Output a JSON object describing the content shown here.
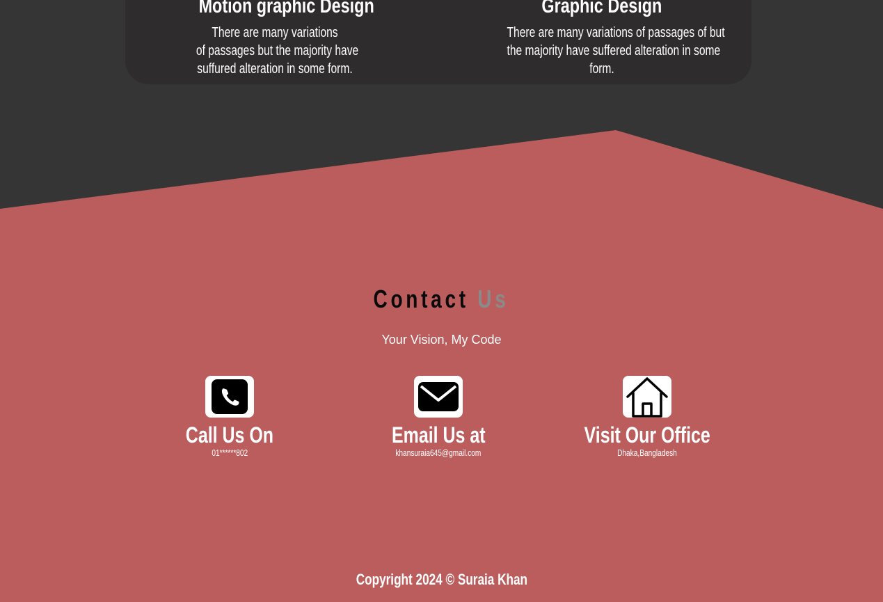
{
  "services": [
    {
      "title": "Motion graphic Design",
      "desc_lines": [
        "There are many variations",
        "of passages but the majority have",
        "suffured alteration in some form."
      ]
    },
    {
      "title": "Graphic Design",
      "desc_lines": [
        "There are many variations of passages of but",
        "the majority have suffered alteration in some",
        "form."
      ]
    }
  ],
  "contact": {
    "title_main": "Contact",
    "title_accent": "Us",
    "tagline": "Your Vision, My Code",
    "cards": [
      {
        "icon": "phone-icon",
        "title": "Call Us On",
        "value": "01******802"
      },
      {
        "icon": "envelope-icon",
        "title": "Email Us at",
        "value": "khansuraia645@gmail.com"
      },
      {
        "icon": "home-icon",
        "title": "Visit Our Office",
        "value": "Dhaka,Bangladesh"
      }
    ]
  },
  "footer": {
    "copyright": "Copyright 2024 © Suraia Khan"
  },
  "colors": {
    "dark_bg": "#353535",
    "card_bg": "#2e2c2c",
    "contact_bg": "#bc5d5d",
    "accent_gray": "#8a8a8a"
  }
}
